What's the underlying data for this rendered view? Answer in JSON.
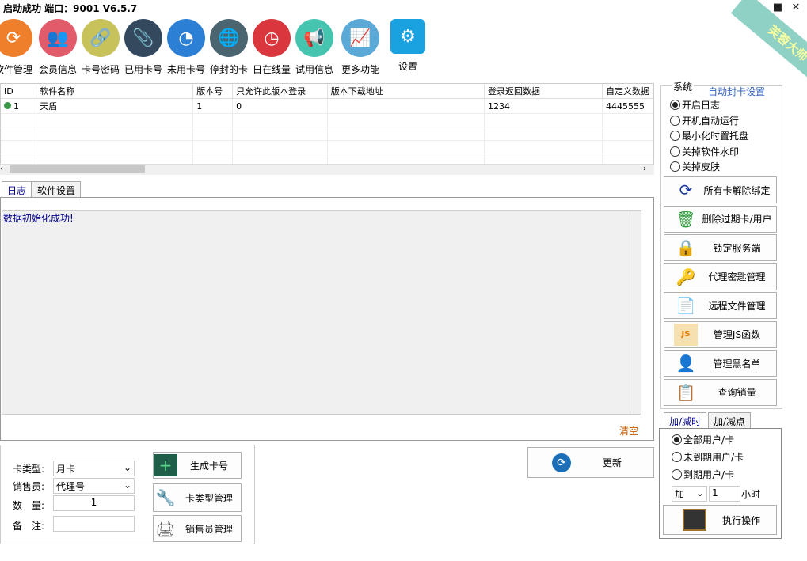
{
  "app": {
    "title": "启动成功   端口：9001 V6.5.7",
    "ribbon": "芙蓉大师"
  },
  "window": {
    "minimize": "▬",
    "maximize": "■",
    "close": "✕"
  },
  "toolbar": [
    {
      "label": "软件管理",
      "icon": "refresh-icon",
      "color": "#f07f2c",
      "glyph": "⟳"
    },
    {
      "label": "会员信息",
      "icon": "users-icon",
      "color": "#e25b6b",
      "glyph": "👥"
    },
    {
      "label": "卡号密码",
      "icon": "link-icon",
      "color": "#c8c25a",
      "glyph": "🔗"
    },
    {
      "label": "已用卡号",
      "icon": "paperclip-icon",
      "color": "#34495e",
      "glyph": "📎"
    },
    {
      "label": "未用卡号",
      "icon": "pie-icon",
      "color": "#2b7fd4",
      "glyph": "◔"
    },
    {
      "label": "停封的卡",
      "icon": "globe-icon",
      "color": "#4a6470",
      "glyph": "🌐"
    },
    {
      "label": "日在线量",
      "icon": "clock-icon",
      "color": "#d9363e",
      "glyph": "◷"
    },
    {
      "label": "试用信息",
      "icon": "megaphone-icon",
      "color": "#45c4b0",
      "glyph": "📢"
    },
    {
      "label": "更多功能",
      "icon": "chart-icon",
      "color": "#5aa9d6",
      "glyph": "📈"
    },
    {
      "label": "设置",
      "icon": "gear-icon",
      "color": "#1aa1e0",
      "glyph": "⚙"
    }
  ],
  "grid": {
    "columns": [
      "ID",
      "软件名称",
      "版本号",
      "只允许此版本登录",
      "版本下载地址",
      "登录返回数据",
      "自定义数据"
    ],
    "rows": [
      [
        "1",
        "天盾",
        "1",
        "0",
        "",
        "1234",
        "4445555"
      ]
    ]
  },
  "tabs": [
    "日志",
    "软件设置"
  ],
  "log": {
    "text": "数据初始化成功!",
    "clear": "清空"
  },
  "form": {
    "card_type_label": "卡类型:",
    "card_type": "月卡",
    "seller_label": "销售员:",
    "seller": "代理号",
    "qty_label": "数　量:",
    "qty": "1",
    "note_label": "备　注:",
    "note": "",
    "generate": "生成卡号",
    "card_type_mgmt": "卡类型管理",
    "seller_mgmt": "销售员管理",
    "update": "更新"
  },
  "system": {
    "title": "系统",
    "auto_ban": "自动封卡设置",
    "options": [
      {
        "label": "开启日志",
        "checked": true
      },
      {
        "label": "开机自动运行",
        "checked": false
      },
      {
        "label": "最小化时置托盘",
        "checked": false
      },
      {
        "label": "关掉软件水印",
        "checked": false
      },
      {
        "label": "关掉皮肤",
        "checked": false
      }
    ],
    "buttons": [
      {
        "label": "所有卡解除绑定",
        "icon": "refresh-icon",
        "glyph": "⟳",
        "color": "#1a3a9a"
      },
      {
        "label": "删除过期卡/用户",
        "icon": "trash-icon",
        "glyph": "🗑",
        "color": "#2c9a3a"
      },
      {
        "label": "锁定服务端",
        "icon": "lock-icon",
        "glyph": "🔒",
        "color": "#b03030"
      },
      {
        "label": "代理密匙管理",
        "icon": "key-icon",
        "glyph": "🔑",
        "color": "#d9a400"
      },
      {
        "label": "远程文件管理",
        "icon": "document-icon",
        "glyph": "📄",
        "color": "#3a6ab0"
      },
      {
        "label": "管理JS函数",
        "icon": "js-file-icon",
        "glyph": "JS",
        "color": "#e07a00"
      },
      {
        "label": "管理黑名单",
        "icon": "contact-book-icon",
        "glyph": "👤",
        "color": "#222"
      },
      {
        "label": "查询销量",
        "icon": "report-icon",
        "glyph": "📋",
        "color": "#d98a00"
      }
    ]
  },
  "addsub": {
    "tabs": [
      "加/减时",
      "加/减点"
    ],
    "options": [
      {
        "label": "全部用户/卡",
        "checked": true
      },
      {
        "label": "未到期用户/卡",
        "checked": false
      },
      {
        "label": "到期用户/卡",
        "checked": false
      }
    ],
    "op": "加",
    "amount": "1",
    "unit": "小时",
    "execute": "执行操作"
  }
}
